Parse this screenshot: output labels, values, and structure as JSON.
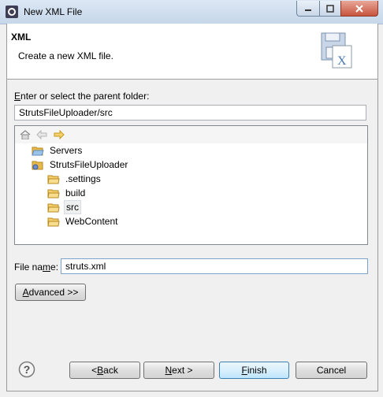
{
  "window": {
    "title": "New XML File",
    "controls": [
      "minimize-icon",
      "maximize-icon",
      "close-icon"
    ]
  },
  "header": {
    "title": "XML",
    "description": "Create a new XML file.",
    "icon": "xml-file-icon"
  },
  "parent_folder": {
    "label_prefix": "E",
    "label_rest": "nter or select the parent folder:",
    "value": "StrutsFileUploader/src"
  },
  "tree": {
    "toolbar": [
      "home-icon",
      "back-arrow-icon",
      "forward-arrow-icon"
    ],
    "items": [
      {
        "label": "Servers",
        "depth": 0,
        "icon": "open-folder-icon"
      },
      {
        "label": "StrutsFileUploader",
        "depth": 0,
        "icon": "project-icon"
      },
      {
        "label": ".settings",
        "depth": 1,
        "icon": "folder-icon"
      },
      {
        "label": "build",
        "depth": 1,
        "icon": "folder-icon"
      },
      {
        "label": "src",
        "depth": 1,
        "icon": "folder-icon",
        "selected": true
      },
      {
        "label": "WebContent",
        "depth": 1,
        "icon": "folder-icon"
      }
    ]
  },
  "file_name": {
    "label_pre": "File na",
    "label_mn": "m",
    "label_post": "e:",
    "value": "struts.xml"
  },
  "buttons": {
    "advanced_pre": "",
    "advanced_mn": "A",
    "advanced_post": "dvanced >>",
    "back_pre": "< ",
    "back_mn": "B",
    "back_post": "ack",
    "next_pre": "",
    "next_mn": "N",
    "next_post": "ext >",
    "finish_pre": "",
    "finish_mn": "F",
    "finish_post": "inish",
    "cancel": "Cancel"
  },
  "colors": {
    "folder": "#e8b94a",
    "selection": "#eef0f0",
    "title_gradient_top": "#dbe7f4",
    "close_red": "#c7543e"
  }
}
